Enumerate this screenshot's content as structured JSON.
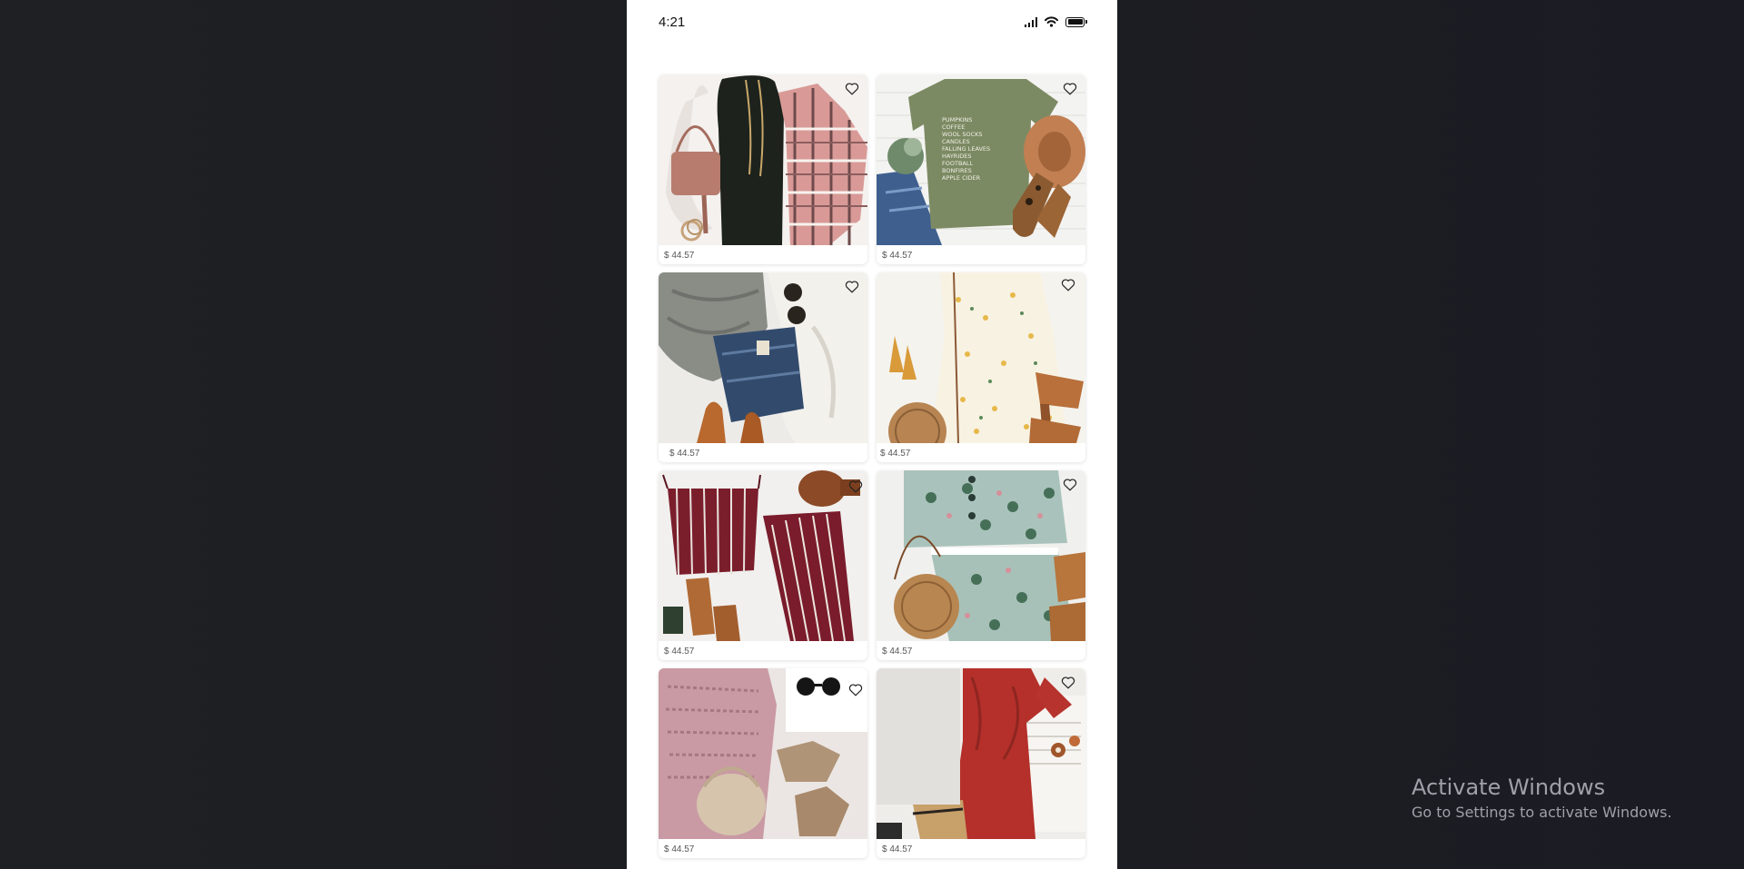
{
  "status_bar": {
    "time": "4:21",
    "icons": [
      "cellular-signal-icon",
      "wifi-icon",
      "battery-icon"
    ]
  },
  "products": [
    {
      "price": "$ 44.57",
      "image": "black dress, plaid shirt and pink crossbody bag flat lay",
      "favorited": false
    },
    {
      "price": "$ 44.57",
      "image": "olive graphic tee with jeans, hat and leopard flats",
      "favorited": false
    },
    {
      "price": "$ 44.57",
      "image": "grey scarf, jeans, cream sweater and tan boots",
      "favorited": false
    },
    {
      "price": "$ 44.57",
      "image": "yellow floral dress with round rattan bag and sandals",
      "favorited": false
    },
    {
      "price": "$ 44.57",
      "image": "striped burgundy top and wide-leg pants with sandals",
      "favorited": false
    },
    {
      "price": "$ 44.57",
      "image": "mint floral two-piece set with rattan bag",
      "favorited": false
    },
    {
      "price": "$ 44.57",
      "image": "pink knit sweater, suede booties and sunglasses",
      "favorited": false
    },
    {
      "price": "$ 44.57",
      "image": "red ruffle dress with wooden earrings",
      "favorited": false
    }
  ],
  "watermark": {
    "title": "Activate Windows",
    "subtitle": "Go to Settings to activate Windows."
  }
}
